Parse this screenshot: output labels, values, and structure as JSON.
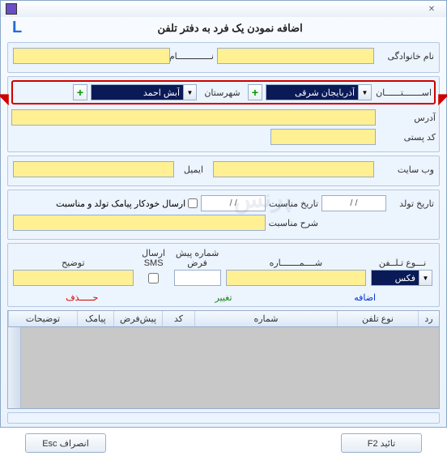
{
  "title": "اضافه نمودن یک فرد به دفتر تلفن",
  "l_char": "L",
  "labels": {
    "lastname": "نام خانوادگی",
    "firstname": "نـــــــــــــام",
    "province": "اســـــــتــــــان",
    "city": "شهرستان",
    "address": "آدرس",
    "postal": "کد پستی",
    "website": "وب سایت",
    "email": "ایمیل",
    "birthdate": "تاریخ تولد",
    "eventdate": "تاریخ مناسبت",
    "autosms": "ارسال خودکار پیامک تولد و مناسبت",
    "eventdesc": "شرح مناسبت",
    "phonetype": "نـــوع تـلــفن",
    "number": "شــــمـــــــاره",
    "prefix": "شماره پیش فرض",
    "sendsms": "ارسال SMS",
    "desc": "توضیح"
  },
  "combos": {
    "province": "آذربایجان شرقی",
    "city": "آبش احمد",
    "phonetype": "فکس"
  },
  "dates": {
    "birth": "/    /",
    "event": "/    /"
  },
  "links": {
    "add": "اضافه",
    "edit": "تغییر",
    "del": "حـــــذف"
  },
  "grid": {
    "h1": "رد",
    "h2": "نوع تلفن",
    "h3": "شماره",
    "h4": "کد",
    "h5": "پیش‌فرض",
    "h6": "پیامک",
    "h7": "توضیحات"
  },
  "buttons": {
    "ok": "تائید F2",
    "cancel": "انصراف Esc"
  }
}
